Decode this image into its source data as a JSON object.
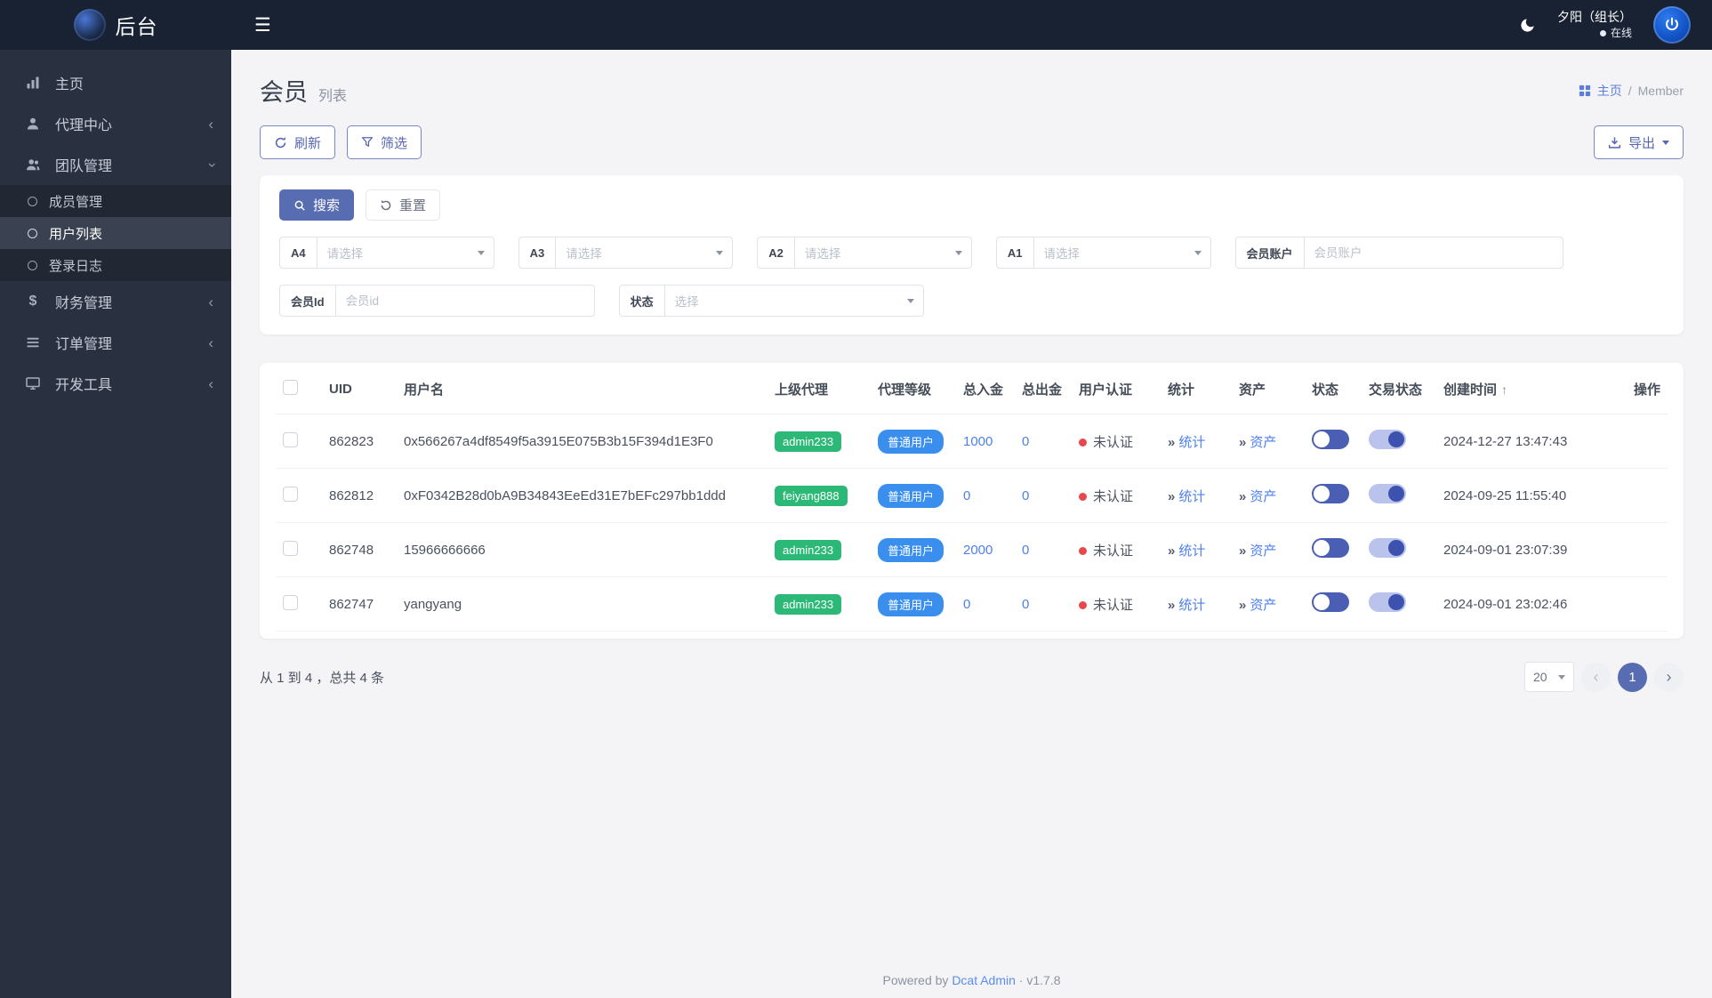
{
  "colors": {
    "primary": "#586cb1",
    "badge_green": "#2cb978",
    "badge_blue": "#3a8fee",
    "link_blue": "#4e80ee",
    "danger_red": "#e9474b",
    "topbar_bg": "#192232",
    "sidebar_bg": "#29303f"
  },
  "topbar": {
    "logo_text": "后台",
    "user_name": "夕阳（组长）",
    "online_status": "在线"
  },
  "sidebar": {
    "items": [
      {
        "label": "主页",
        "icon": "bar-chart-icon"
      },
      {
        "label": "代理中心",
        "icon": "user-icon",
        "state": "collapsed"
      },
      {
        "label": "团队管理",
        "icon": "team-icon",
        "state": "expanded"
      },
      {
        "label": "财务管理",
        "icon": "dollar-icon",
        "state": "collapsed"
      },
      {
        "label": "订单管理",
        "icon": "list-icon",
        "state": "collapsed"
      },
      {
        "label": "开发工具",
        "icon": "devtools-icon",
        "state": "collapsed"
      }
    ],
    "team_submenu": [
      {
        "label": "成员管理",
        "active": false
      },
      {
        "label": "用户列表",
        "active": true
      },
      {
        "label": "登录日志",
        "active": false
      }
    ]
  },
  "page": {
    "title": "会员",
    "subtitle": "列表",
    "breadcrumb_home": "主页",
    "breadcrumb_sep": "/",
    "breadcrumb_current": "Member"
  },
  "toolbar": {
    "refresh_label": "刷新",
    "filter_label": "筛选",
    "export_label": "导出"
  },
  "filters": {
    "search_label": "搜索",
    "reset_label": "重置",
    "selects": [
      {
        "label": "A4",
        "placeholder": "请选择"
      },
      {
        "label": "A3",
        "placeholder": "请选择"
      },
      {
        "label": "A2",
        "placeholder": "请选择"
      },
      {
        "label": "A1",
        "placeholder": "请选择"
      }
    ],
    "account": {
      "label": "会员账户",
      "placeholder": "会员账户"
    },
    "member_id": {
      "label": "会员Id",
      "placeholder": "会员id"
    },
    "status": {
      "label": "状态",
      "placeholder": "选择"
    }
  },
  "table": {
    "headers": [
      "UID",
      "用户名",
      "上级代理",
      "代理等级",
      "总入金",
      "总出金",
      "用户认证",
      "统计",
      "资产",
      "状态",
      "交易状态",
      "创建时间",
      "操作"
    ],
    "rows": [
      {
        "uid": "862823",
        "username": "0x566267a4df8549f5a3915E075B3b15F394d1E3F0",
        "agent": "admin233",
        "level": "普通用户",
        "total_in": "1000",
        "total_out": "0",
        "auth": "未认证",
        "stats": "统计",
        "assets": "资产",
        "created": "2024-12-27 13:47:43"
      },
      {
        "uid": "862812",
        "username": "0xF0342B28d0bA9B34843EeEd31E7bEFc297bb1ddd",
        "agent": "feiyang888",
        "level": "普通用户",
        "total_in": "0",
        "total_out": "0",
        "auth": "未认证",
        "stats": "统计",
        "assets": "资产",
        "created": "2024-09-25 11:55:40"
      },
      {
        "uid": "862748",
        "username": "15966666666",
        "agent": "admin233",
        "level": "普通用户",
        "total_in": "2000",
        "total_out": "0",
        "auth": "未认证",
        "stats": "统计",
        "assets": "资产",
        "created": "2024-09-01 23:07:39"
      },
      {
        "uid": "862747",
        "username": "yangyang",
        "agent": "admin233",
        "level": "普通用户",
        "total_in": "0",
        "total_out": "0",
        "auth": "未认证",
        "stats": "统计",
        "assets": "资产",
        "created": "2024-09-01 23:02:46"
      }
    ]
  },
  "pagination": {
    "summary": "从 1 到 4 ，总共 4 条",
    "page_size": "20",
    "current_page": "1"
  },
  "footer": {
    "powered_by": "Powered by",
    "brand": "Dcat Admin",
    "separator": "·",
    "version": "v1.7.8"
  }
}
